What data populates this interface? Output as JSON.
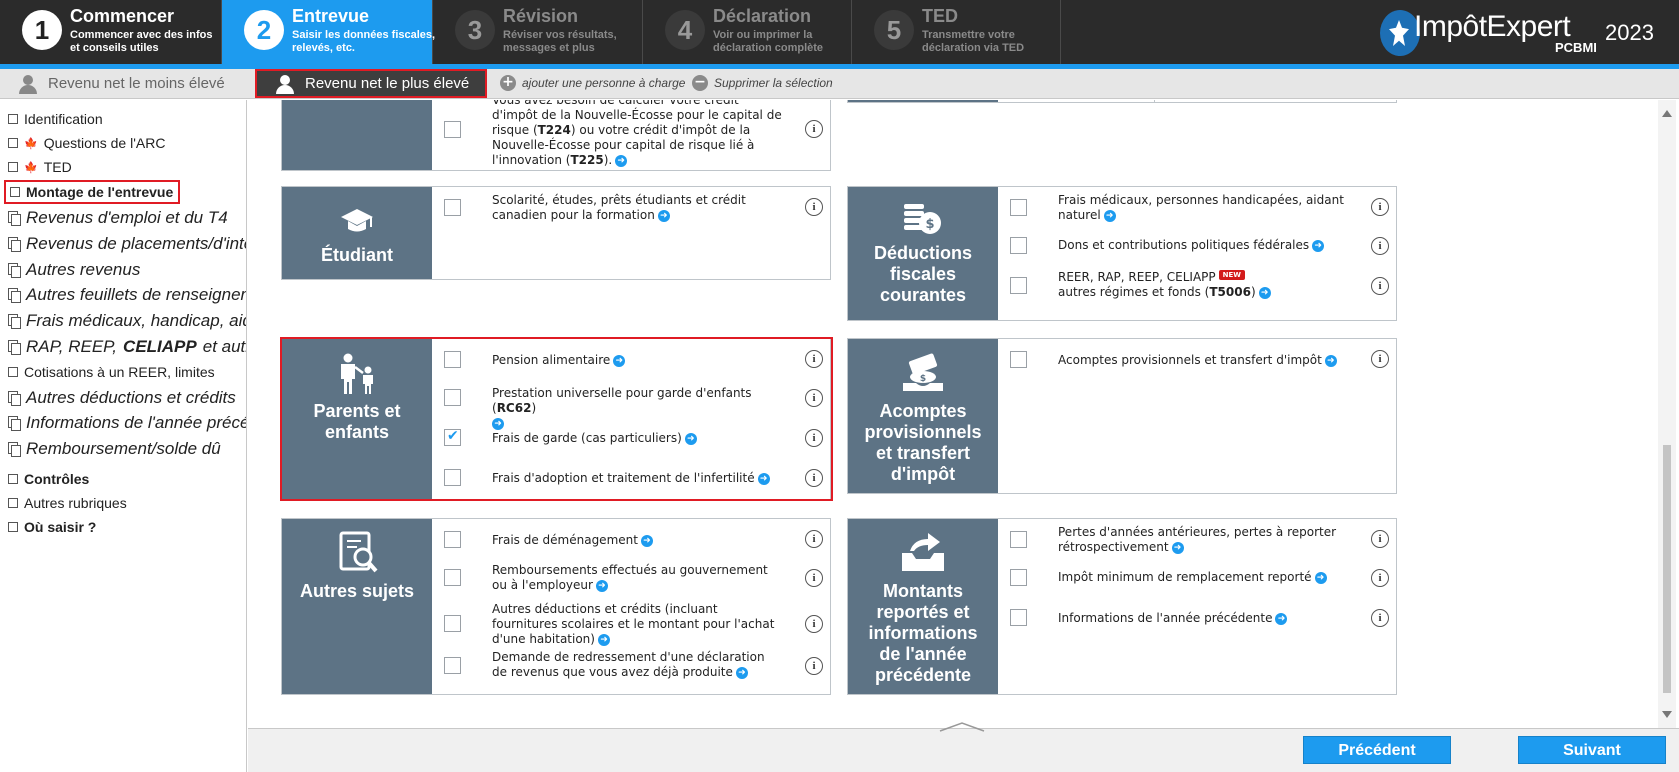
{
  "steps": [
    {
      "num": "1",
      "title": "Commencer",
      "sub": "Commencer avec des infos et conseils utiles"
    },
    {
      "num": "2",
      "title": "Entrevue",
      "sub": "Saisir les données fiscales, relevés, etc."
    },
    {
      "num": "3",
      "title": "Révision",
      "sub": "Réviser vos résultats, messages et plus"
    },
    {
      "num": "4",
      "title": "Déclaration",
      "sub": "Voir ou imprimer la déclaration complète"
    },
    {
      "num": "5",
      "title": "TED",
      "sub": "Transmettre votre déclaration via TED"
    }
  ],
  "brand": {
    "name": "ImpôtExpert",
    "sub": "PCBMI",
    "year": "2023"
  },
  "persons": {
    "low": "Revenu net le moins  élevé",
    "high": "Revenu net le plus élevé",
    "add": "ajouter une personne à charge",
    "remove": "Supprimer la sélection"
  },
  "sidebar": [
    {
      "label": "Identification",
      "type": "small"
    },
    {
      "label": "Questions de l'ARC",
      "type": "small"
    },
    {
      "label": "TED",
      "type": "small"
    },
    {
      "label": "Montage de l'entrevue",
      "type": "small-bold"
    },
    {
      "label": "Revenus d'emploi et du T4",
      "type": "big"
    },
    {
      "label": "Revenus de placements/d'intérêts",
      "type": "big"
    },
    {
      "label": "Autres revenus",
      "type": "big"
    },
    {
      "label": "Autres feuillets de renseignements",
      "type": "big"
    },
    {
      "label": "Frais médicaux, handicap, aidant",
      "type": "big"
    },
    {
      "label": "RAP, REEP,",
      "label2": "CELIAPP",
      "label3": "et autres",
      "type": "big"
    },
    {
      "label": "Cotisations à un REER, limites",
      "type": "small"
    },
    {
      "label": "Autres déductions et crédits",
      "type": "big"
    },
    {
      "label": "Informations de l'année précédente",
      "type": "big"
    },
    {
      "label": "Remboursement/solde dû",
      "type": "big"
    },
    {
      "label": "Contrôles",
      "type": "small-bold"
    },
    {
      "label": "Autres rubriques",
      "type": "small"
    },
    {
      "label": "Où saisir ?",
      "type": "small-bold"
    }
  ],
  "cards": {
    "top_left": {
      "t1": "Vous avez besoin de calculer votre crédit d'impôt de la Nouvelle-Écosse pour le capital de risque (",
      "t1b": "T224",
      "t2": ") ou votre crédit d'impôt de la Nouvelle-Écosse pour capital de risque lié à l'innovation (",
      "t2b": "T225",
      "t3": ")."
    },
    "etudiant": {
      "title": "Étudiant",
      "item1": "Scolarité, études, prêts étudiants et crédit canadien pour la formation"
    },
    "deductions": {
      "title_l1": "Déductions",
      "title_l2": "fiscales",
      "title_l3": "courantes",
      "item1": "Frais médicaux, personnes handicapées, aidant naturel",
      "item2": "Dons et contributions politiques fédérales",
      "item3a": "REER, RAP, REEP, CELIAPP",
      "new": "NEW",
      "item3b": "autres régimes et fonds (",
      "item3c": "T5006",
      "item3d": ")"
    },
    "parents": {
      "title_l1": "Parents et",
      "title_l2": "enfants",
      "item1": "Pension alimentaire",
      "item2a": "Prestation universelle pour garde d'enfants (",
      "item2b": "RC62",
      "item2c": ")",
      "item3": "Frais de garde (cas particuliers)",
      "item4": "Frais d'adoption et traitement de l'infertilité"
    },
    "acomptes": {
      "title_l1": "Acomptes",
      "title_l2": "provisionnels",
      "title_l3": "et transfert",
      "title_l4": "d'impôt",
      "item1": "Acomptes provisionnels et transfert d'impôt"
    },
    "autres": {
      "title": "Autres sujets",
      "item1": "Frais de déménagement",
      "item2": "Remboursements effectués au gouvernement ou à l'employeur",
      "item3": "Autres déductions et crédits (incluant fournitures scolaires et le montant pour l'achat d'une habitation)",
      "item4": "Demande de redressement d'une déclaration de revenus que vous avez déjà produite"
    },
    "montants": {
      "title_l1": "Montants",
      "title_l2": "reportés et",
      "title_l3": "informations",
      "title_l4": "de l'année",
      "title_l5": "précédente",
      "item1": "Pertes d'années antérieures, pertes à reporter rétrospectivement",
      "item2": "Impôt minimum de remplacement reporté",
      "item3": "Informations de l'année précédente"
    }
  },
  "info_glyph": "i",
  "footer": {
    "prev": "Précédent",
    "next": "Suivant"
  },
  "colors": {
    "accent": "#1d9bef",
    "panel": "#5d7385",
    "highlight": "#e01b24",
    "topbar": "#2b2b2b"
  }
}
